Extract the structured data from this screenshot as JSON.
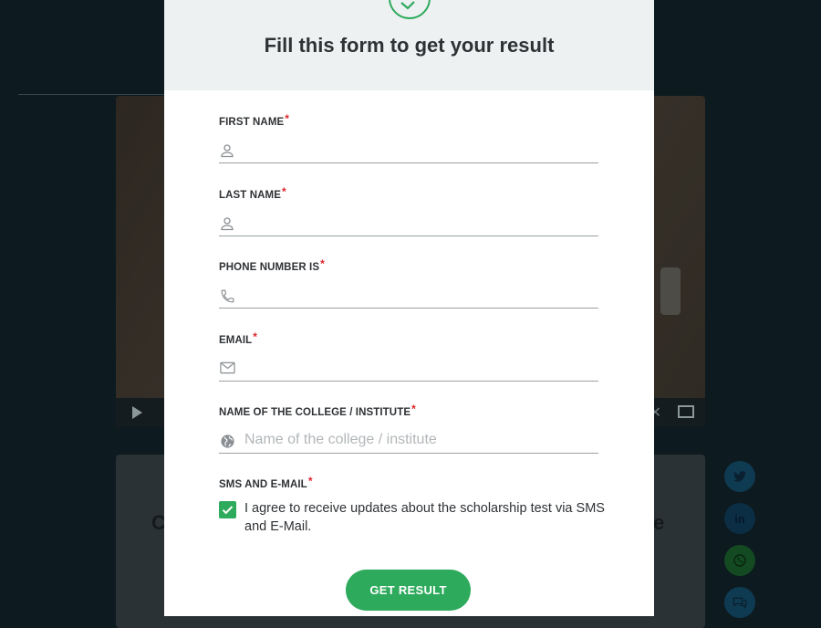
{
  "modal": {
    "title": "Fill this form to get your result",
    "fields": [
      {
        "label": "FIRST NAME",
        "required": "*",
        "icon": "person-icon",
        "value": "",
        "placeholder": ""
      },
      {
        "label": "LAST NAME",
        "required": "*",
        "icon": "person-icon",
        "value": "",
        "placeholder": ""
      },
      {
        "label": "PHONE NUMBER IS",
        "required": "*",
        "icon": "phone-icon",
        "value": "",
        "placeholder": ""
      },
      {
        "label": "EMAIL",
        "required": "*",
        "icon": "mail-icon",
        "value": "",
        "placeholder": ""
      },
      {
        "label": "NAME OF THE COLLEGE / INSTITUTE",
        "required": "*",
        "icon": "globe-icon",
        "value": "",
        "placeholder": "Name of the college / institute"
      }
    ],
    "consent": {
      "label": "SMS AND E-MAIL",
      "required": "*",
      "checked": true,
      "text": "I agree to receive updates about the scholarship test via SMS and E-Mail."
    },
    "submit_label": "GET RESULT"
  },
  "background": {
    "social_icons": [
      "twitter-icon",
      "linkedin-icon",
      "whatsapp-icon",
      "comment-icon"
    ]
  },
  "colors": {
    "accent": "#2eaa5c",
    "required": "#e0242c",
    "overlay": "#0d1a1f",
    "header_bg": "#eef1f2"
  }
}
